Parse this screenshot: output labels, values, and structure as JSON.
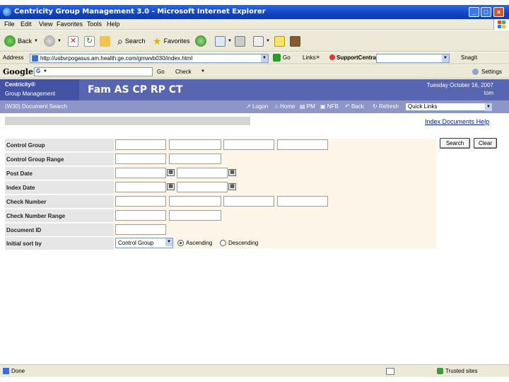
{
  "window": {
    "title": "Centricity Group Management 3.0 - Microsoft Internet Explorer"
  },
  "menu": [
    "File",
    "Edit",
    "View",
    "Favorites",
    "Tools",
    "Help"
  ],
  "toolbar": {
    "back": "Back",
    "search": "Search",
    "favorites": "Favorites"
  },
  "address": {
    "label": "Address",
    "url": "http://usbvrpogasus.am.health.ge.com/gmwvb030/index.html",
    "go": "Go",
    "links": "Links",
    "support": "SupportCentral",
    "snagit": "SnagIt"
  },
  "google": {
    "logo": "Google",
    "go": "Go",
    "check": "Check",
    "settings": "Settings"
  },
  "app": {
    "logo_line1": "Centricity®",
    "logo_line2": "Group Management",
    "brand": "Fam AS CP RP CT",
    "date": "Tuesday October 16, 2007",
    "user": "tom"
  },
  "nav": {
    "title": "(W30) Document Search",
    "links": [
      "Logon",
      "Home",
      "PM",
      "NFB",
      "Back",
      "Refresh"
    ],
    "quick_links": "Quick Links"
  },
  "links": {
    "index_documents": "Index Documents",
    "help": "Help"
  },
  "form": {
    "labels": [
      "Control Group",
      "Control Group Range",
      "Post Date",
      "Index Date",
      "Check Number",
      "Check Number Range",
      "Document ID",
      "Initial sort by"
    ],
    "sort_select": "Control Group",
    "ascending": "Ascending",
    "descending": "Descending",
    "search_button": "Search",
    "clear_button": "Clear"
  },
  "status": {
    "left": "Done",
    "right": "Trusted sites"
  },
  "colors": {
    "header": "#5866b1",
    "nav": "#8e95c9",
    "form_bg": "#fdf6e8"
  }
}
